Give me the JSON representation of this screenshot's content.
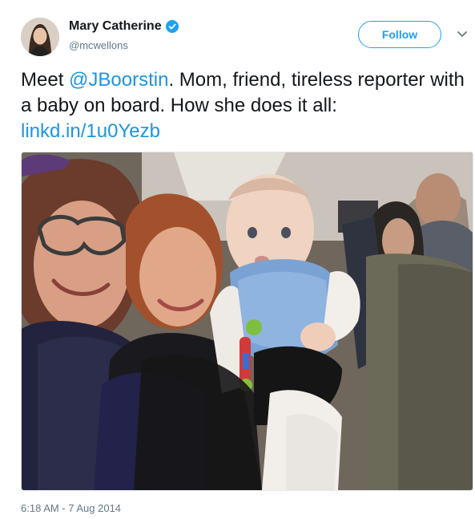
{
  "author": {
    "display_name": "Mary Catherine",
    "handle": "@mcwellons",
    "verified": true
  },
  "actions": {
    "follow_label": "Follow",
    "more_icon": "chevron-down-icon"
  },
  "tweet": {
    "text_prefix": "Meet ",
    "mention": "@JBoorstin",
    "text_middle": ". Mom, friend, tireless reporter with a baby on board. How she does it all: ",
    "link": "linkd.in/1u0Yezb"
  },
  "timestamp": "6:18 AM - 7 Aug 2014",
  "colors": {
    "accent": "#1da1f2",
    "link": "#1b95e0",
    "secondary_text": "#657786"
  }
}
